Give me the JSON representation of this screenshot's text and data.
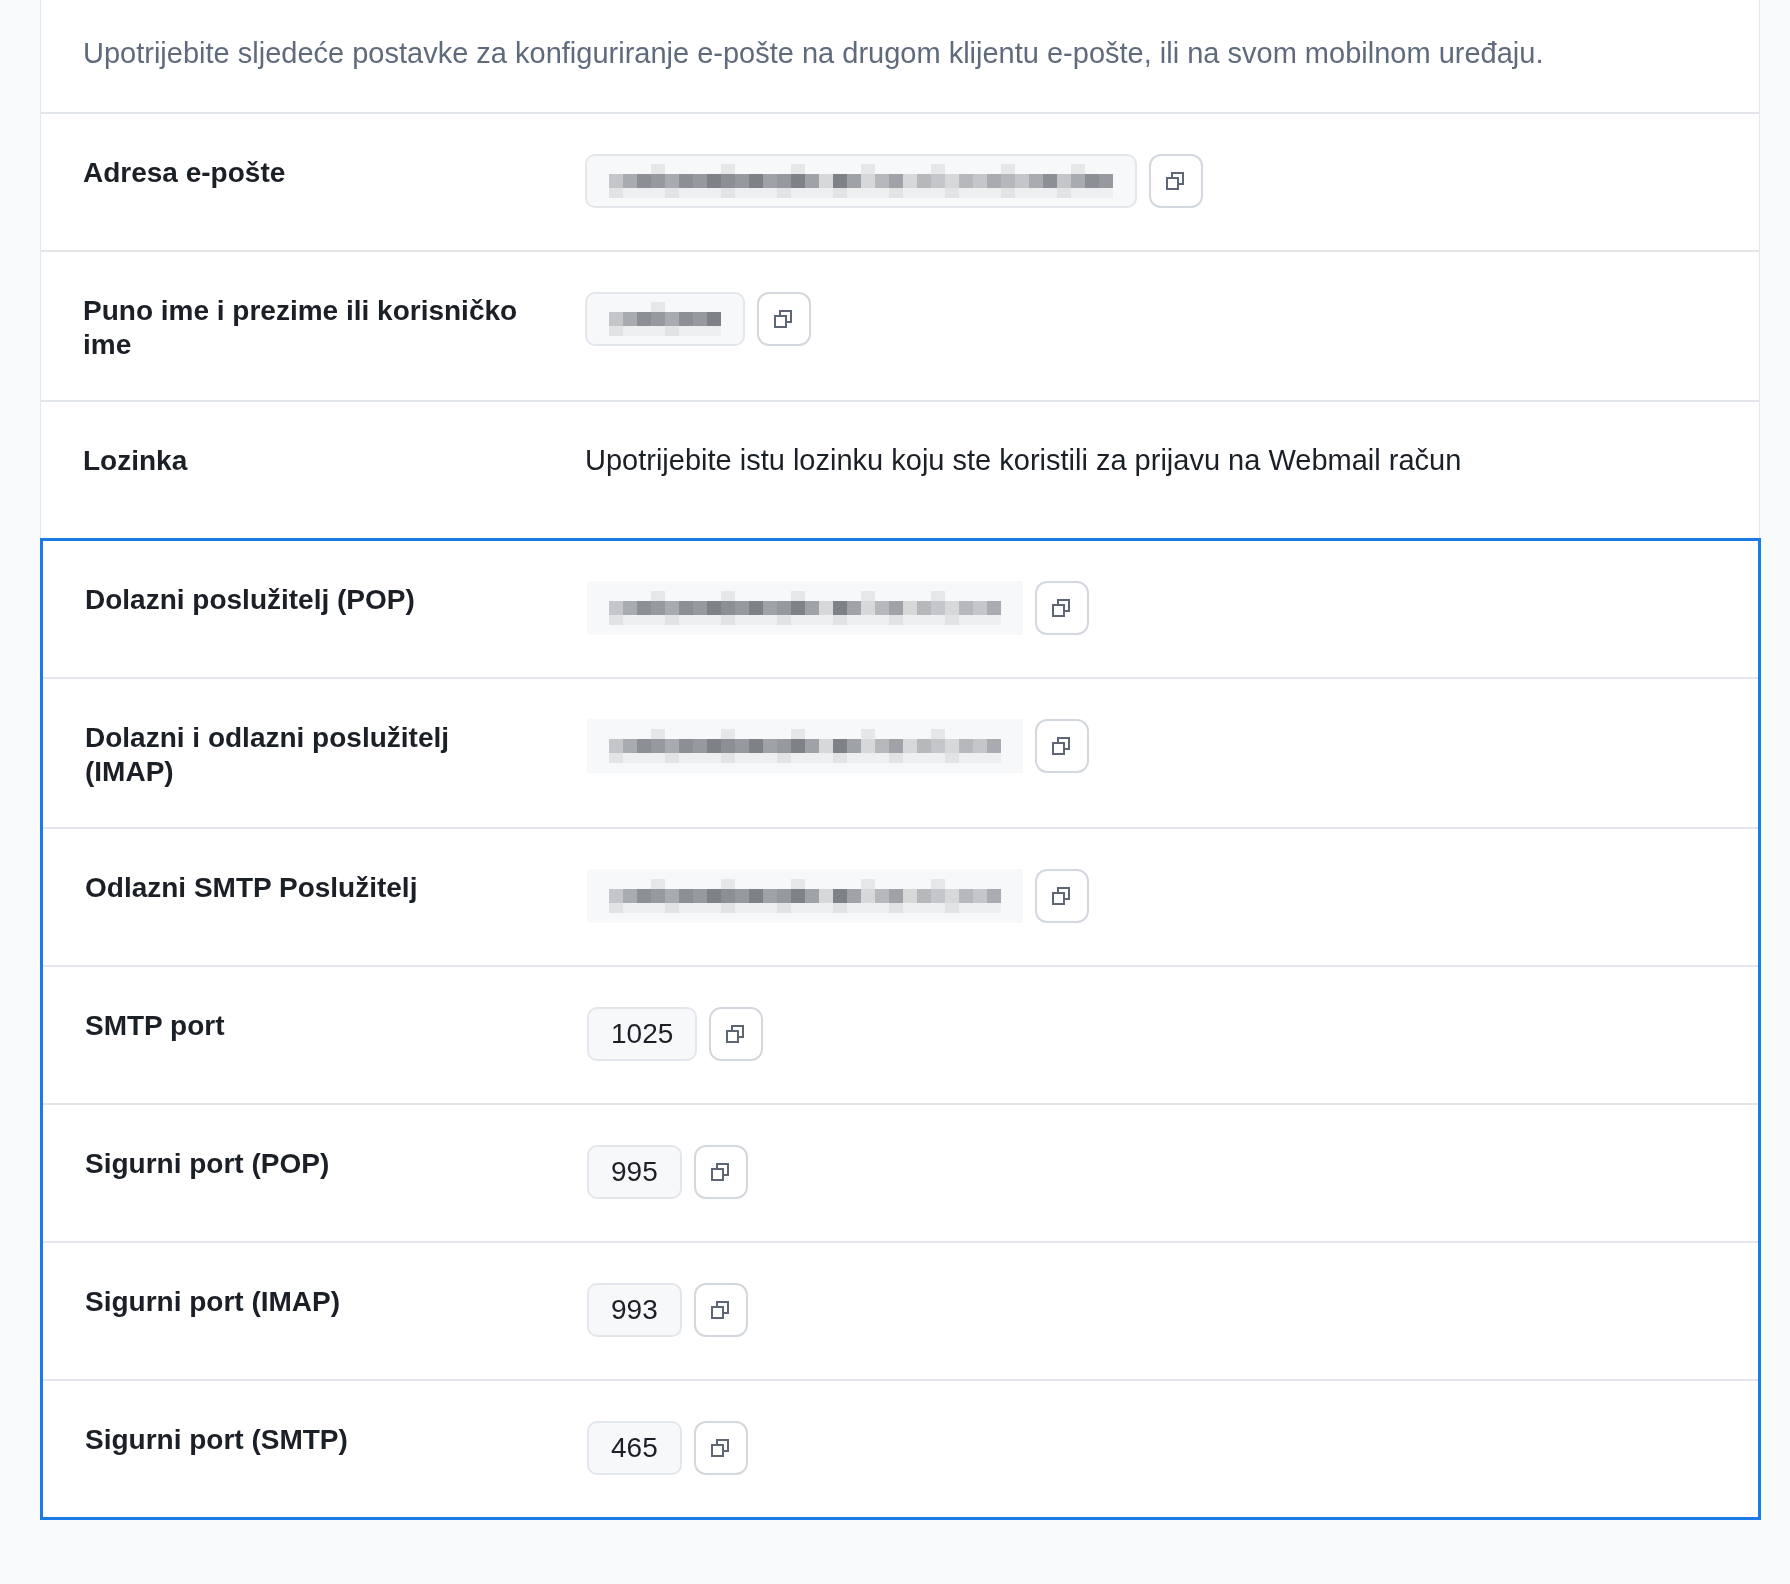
{
  "description": "Upotrijebite sljedeće postavke za konfiguriranje e-pošte na drugom klijentu e-pošte, ili na svom mobilnom uređaju.",
  "sections": [
    {
      "highlighted": false,
      "rows": [
        {
          "label": "Adresa e-pošte",
          "value": {
            "kind": "redacted",
            "bordered": true
          },
          "copy": true
        },
        {
          "label": "Puno ime i prezime ili korisničko ime",
          "value": {
            "kind": "redacted",
            "bordered": true
          },
          "copy": true
        },
        {
          "label": "Lozinka",
          "value": {
            "kind": "text",
            "text": "Upotrijebite istu lozinku koju ste koristili za prijavu na Webmail račun"
          },
          "copy": false
        }
      ]
    },
    {
      "highlighted": true,
      "rows": [
        {
          "label": "Dolazni poslužitelj (POP)",
          "value": {
            "kind": "redacted",
            "bordered": false
          },
          "copy": true
        },
        {
          "label": "Dolazni i odlazni poslužitelj (IMAP)",
          "value": {
            "kind": "redacted",
            "bordered": false
          },
          "copy": true
        },
        {
          "label": "Odlazni SMTP Poslužitelj",
          "value": {
            "kind": "redacted",
            "bordered": false
          },
          "copy": true
        },
        {
          "label": "SMTP port",
          "value": {
            "kind": "field",
            "text": "1025"
          },
          "copy": true
        },
        {
          "label": "Sigurni port (POP)",
          "value": {
            "kind": "field",
            "text": "995"
          },
          "copy": true
        },
        {
          "label": "Sigurni port (IMAP)",
          "value": {
            "kind": "field",
            "text": "993"
          },
          "copy": true
        },
        {
          "label": "Sigurni port (SMTP)",
          "value": {
            "kind": "field",
            "text": "465"
          },
          "copy": true
        }
      ]
    }
  ]
}
